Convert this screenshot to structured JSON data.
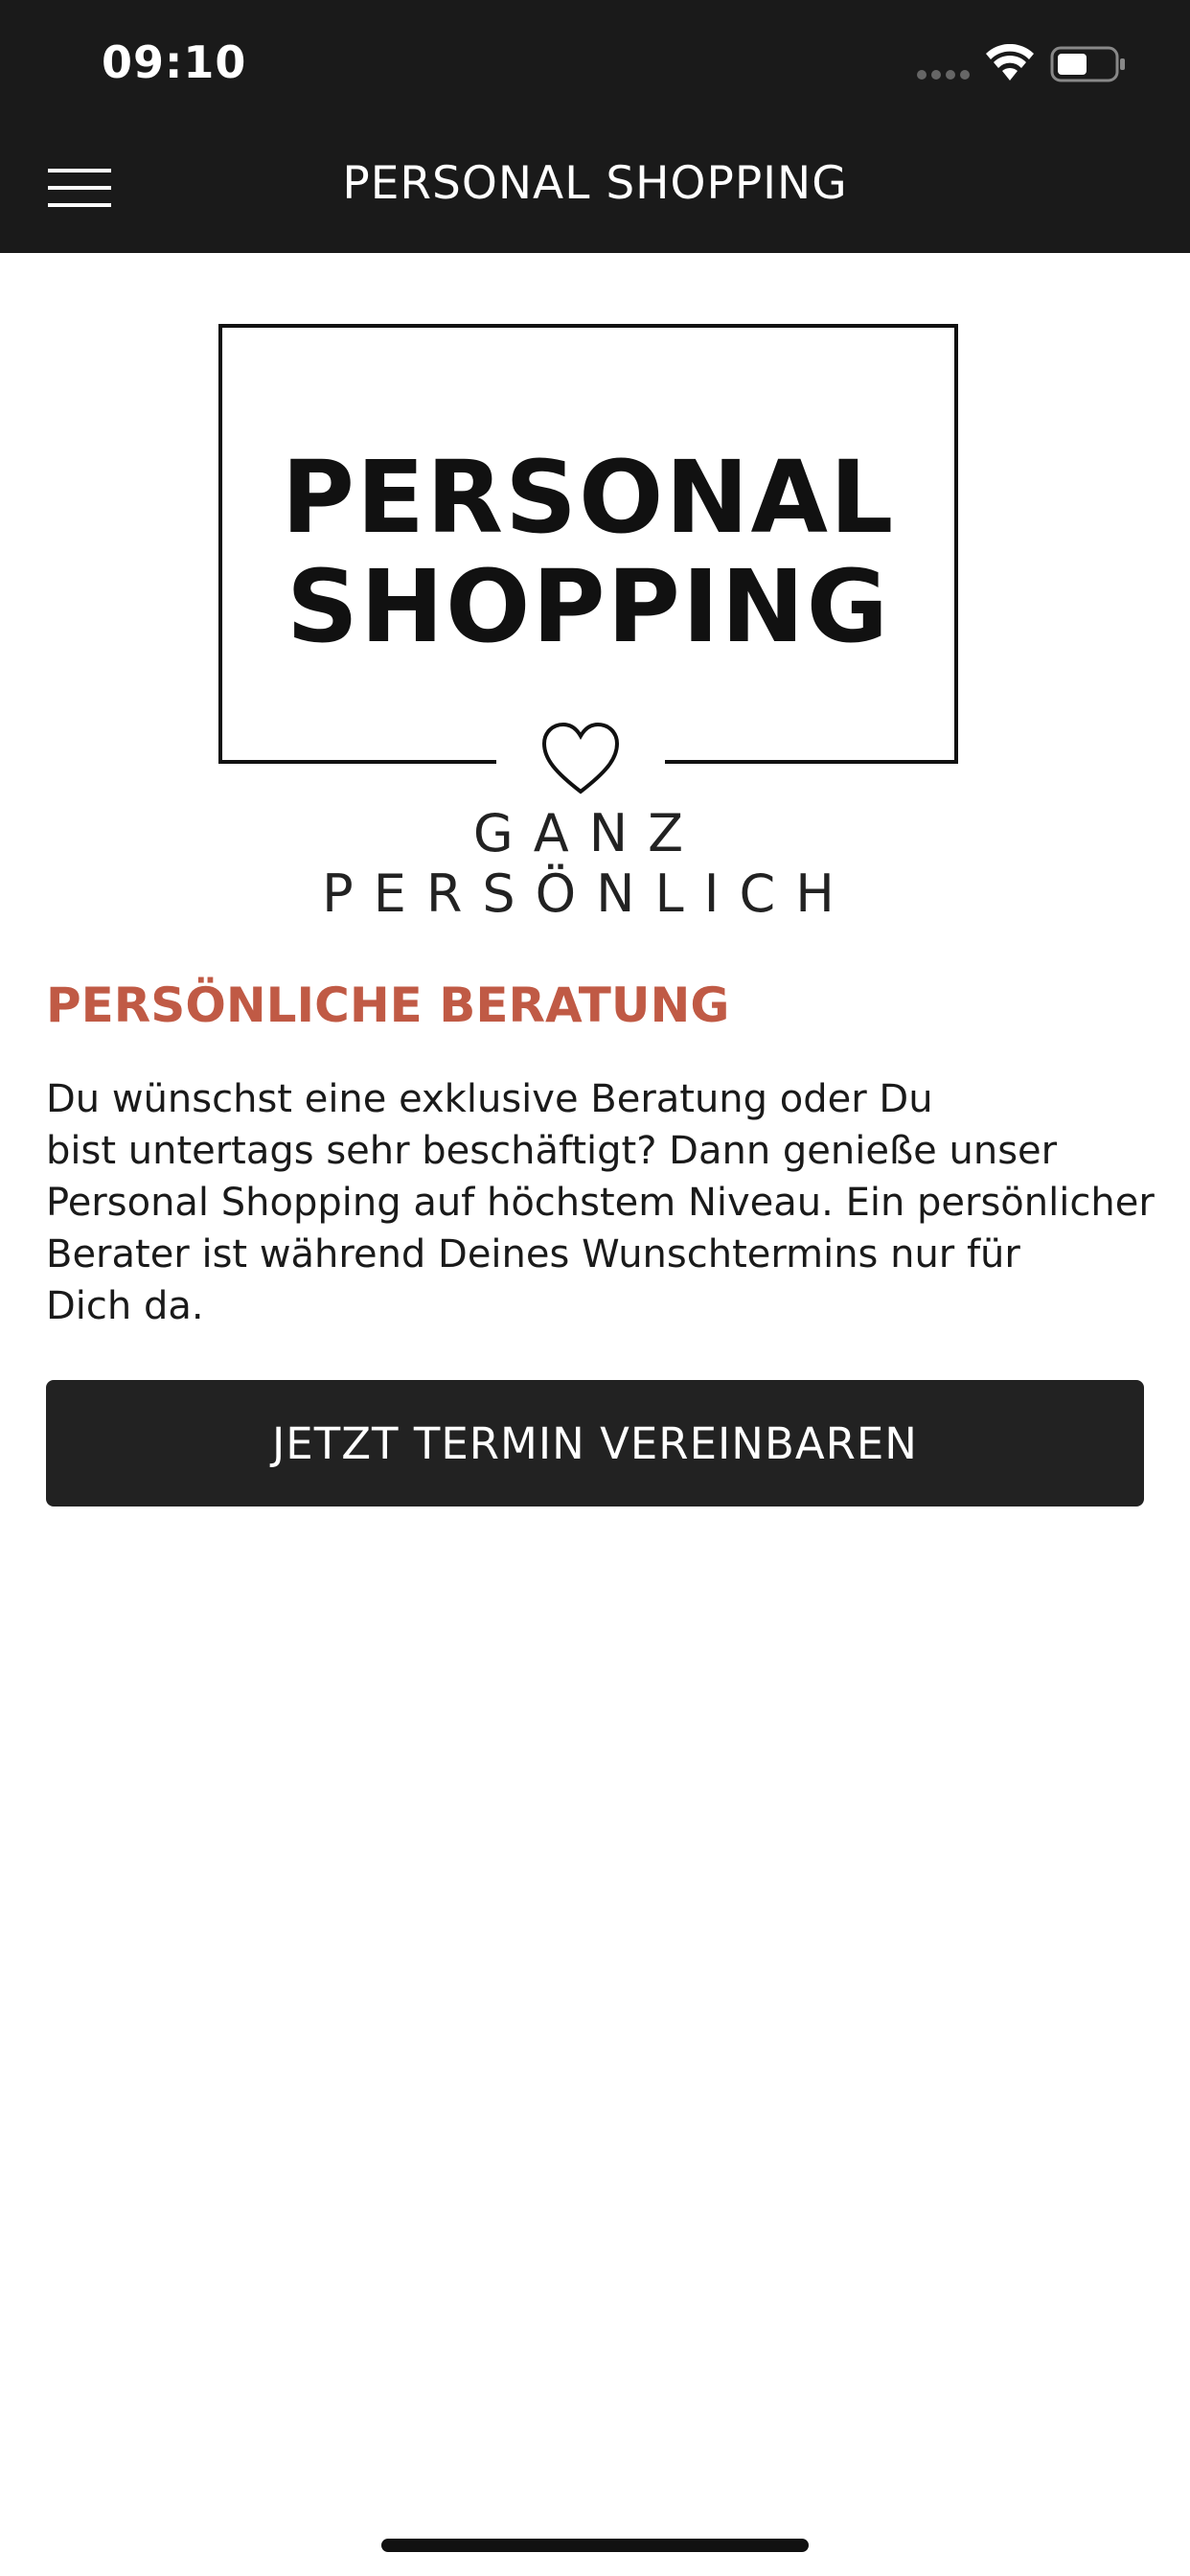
{
  "status_bar": {
    "time": "09:10"
  },
  "header": {
    "title": "PERSONAL SHOPPING",
    "menu_icon": "hamburger-menu-icon"
  },
  "logo": {
    "line1": "PERSONAL",
    "line2": "SHOPPING",
    "tagline": "GANZ PERSÖNLICH",
    "icon": "heart-icon"
  },
  "content": {
    "heading": "PERSÖNLICHE BERATUNG",
    "body_lines": [
      "Du wünschst eine exklusive Beratung oder Du",
      "bist untertags sehr beschäftigt? Dann genieße unser",
      "Personal Shopping auf höchstem Niveau. Ein persönlicher",
      "Berater ist während Deines Wunschtermins nur für",
      "Dich da."
    ],
    "cta_label": "JETZT TERMIN VEREINBAREN"
  },
  "colors": {
    "header_bg": "#1a1a1a",
    "accent": "#c05a45",
    "button_bg": "#222222"
  }
}
